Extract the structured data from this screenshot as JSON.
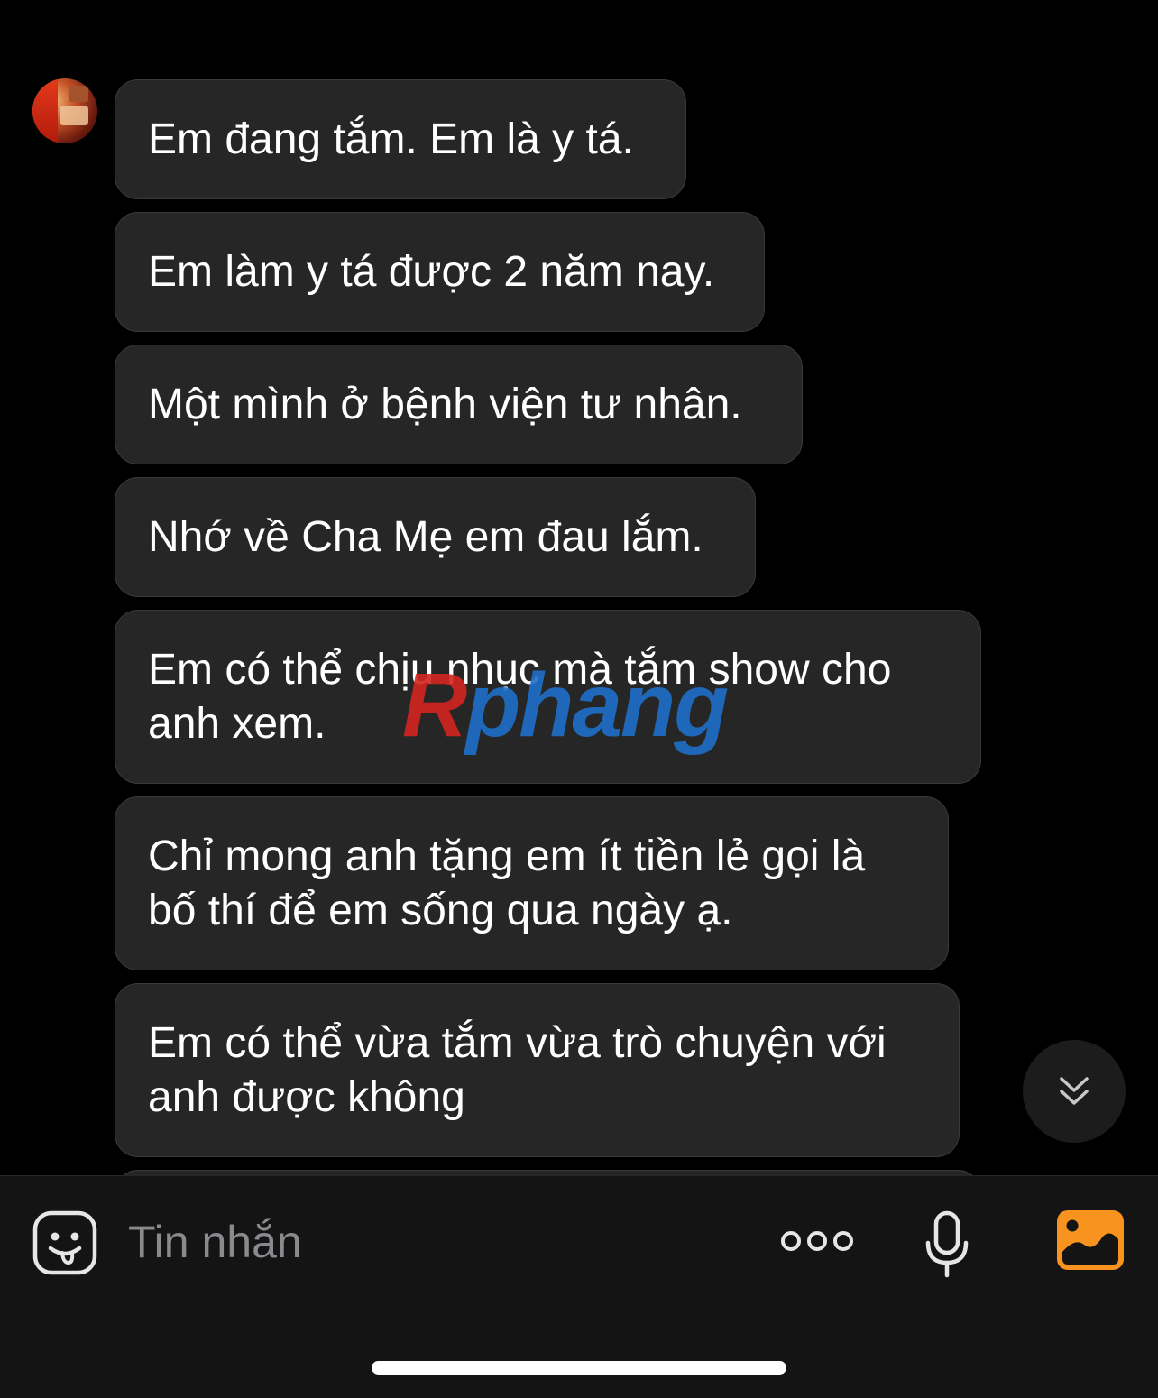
{
  "messages": [
    {
      "text": "Em đang tắm. Em là y tá."
    },
    {
      "text": "Em làm y tá được 2 năm nay."
    },
    {
      "text": "Một mình ở bệnh viện tư nhân."
    },
    {
      "text": "Nhớ về Cha Mẹ em đau lắm."
    },
    {
      "line1": "Em có thể chịu nhục mà tắm show cho",
      "line2": "anh xem."
    },
    {
      "line1": "Chỉ mong anh tặng em ít tiền lẻ gọi là",
      "line2": "bố thí để em sống qua ngày ạ."
    },
    {
      "line1": "Em có thể vừa tắm vừa trò chuyện với",
      "line2": "anh được không"
    }
  ],
  "watermark": {
    "first": "R",
    "rest": "phang"
  },
  "composer": {
    "placeholder": "Tin nhắn",
    "icons": {
      "emoji": "sticker-face-icon",
      "more": "more-dots-icon",
      "mic": "microphone-icon",
      "image": "image-gallery-icon",
      "scroll": "double-chevron-down-icon"
    }
  },
  "colors": {
    "background": "#000000",
    "bubble": "#262626",
    "accent_orange": "#F7931E",
    "watermark_red": "#D3251F",
    "watermark_blue": "#1F6FC9"
  }
}
